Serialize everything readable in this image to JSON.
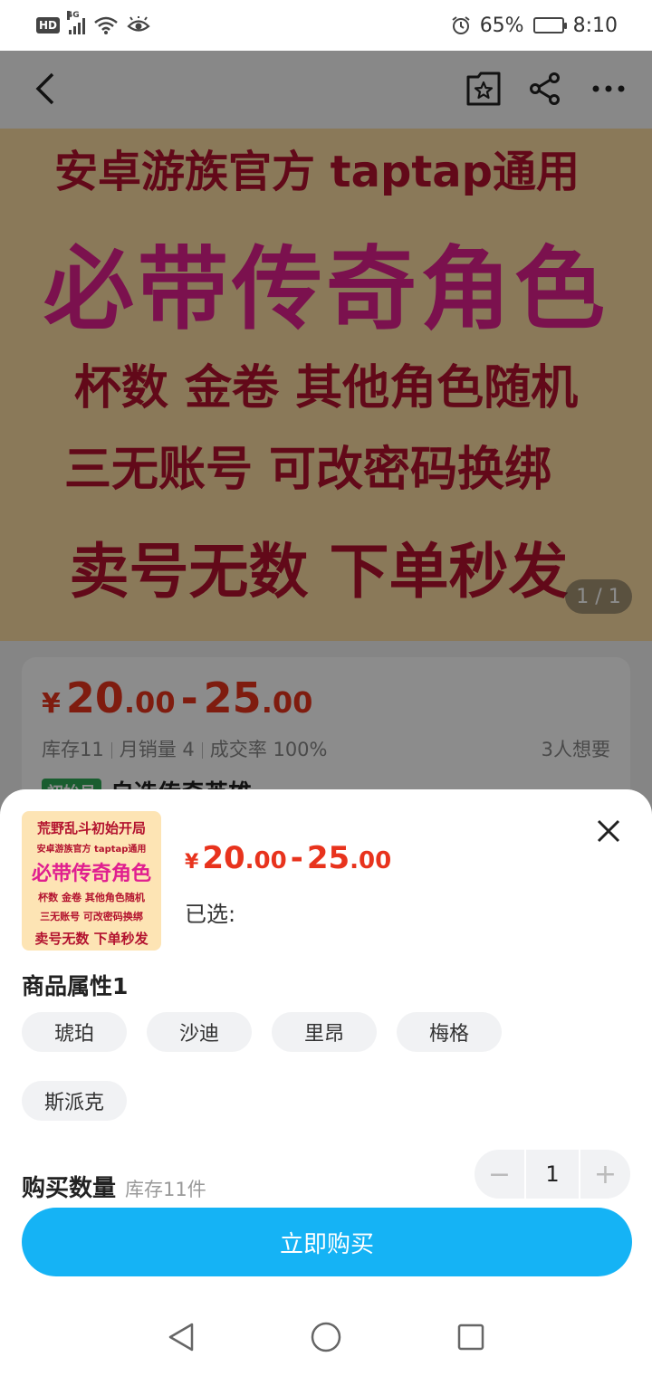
{
  "status_bar": {
    "hd": "HD",
    "network": "4G",
    "battery_pct": "65%",
    "battery_level": 0.65,
    "time": "8:10"
  },
  "banner": {
    "line1": "安卓游族官方  taptap通用",
    "line2": "必带传奇角色",
    "line3": "杯数  金卷  其他角色随机",
    "line4": "三无账号  可改密码换绑",
    "line5": "卖号无数  下单秒发",
    "page_indicator": "1 / 1"
  },
  "product": {
    "currency": "¥",
    "price_low_int": "20",
    "price_low_dec": ".00",
    "price_sep": "-",
    "price_high_int": "25",
    "price_high_dec": ".00",
    "stock": "库存11",
    "monthly_sales": "月销量 4",
    "deal_rate": "成交率 100%",
    "wants": "3人想要",
    "tag": "初始号",
    "title": "自选传奇英雄"
  },
  "sheet": {
    "thumb": {
      "l1": "荒野乱斗初始开局",
      "l2": "安卓游族官方  taptap通用",
      "l3": "必带传奇角色",
      "l4": "杯数  金卷  其他角色随机",
      "l5": "三无账号  可改密码换绑",
      "l6": "卖号无数  下单秒发"
    },
    "selected_label": "已选:",
    "attr_title": "商品属性1",
    "options": [
      "琥珀",
      "沙迪",
      "里昂",
      "梅格",
      "斯派克"
    ],
    "qty_label": "购买数量",
    "qty_stock": "库存11件",
    "qty_minus": "−",
    "qty_value": "1",
    "qty_plus": "+",
    "buy_label": "立即购买"
  },
  "colors": {
    "price_red": "#e8331d",
    "buy_blue": "#15b3f5",
    "banner_bg": "#fcdca3",
    "banner_red": "#b3122e",
    "banner_pink": "#e01f8f"
  }
}
